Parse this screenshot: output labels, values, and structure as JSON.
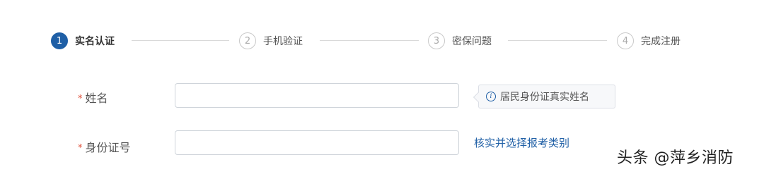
{
  "steps": [
    {
      "number": "1",
      "label": "实名认证",
      "state": "active"
    },
    {
      "number": "2",
      "label": "手机验证",
      "state": "inactive"
    },
    {
      "number": "3",
      "label": "密保问题",
      "state": "inactive"
    },
    {
      "number": "4",
      "label": "完成注册",
      "state": "inactive"
    }
  ],
  "form": {
    "required_mark": "*",
    "name_label": "姓名",
    "name_value": "",
    "name_tip": "居民身份证真实姓名",
    "id_label": "身份证号",
    "id_value": "",
    "verify_link": "核实并选择报考类别"
  },
  "watermark": "头条 @萍乡消防",
  "colors": {
    "accent": "#1f5fa6",
    "required": "#e0533d"
  },
  "icons": {
    "tip_icon": "info-icon"
  }
}
